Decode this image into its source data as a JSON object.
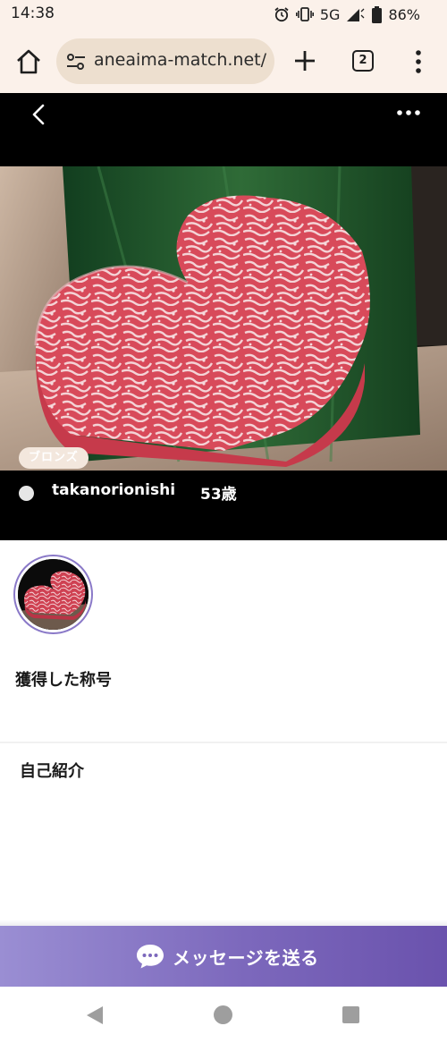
{
  "status_bar": {
    "time": "14:38",
    "network": "5G",
    "battery": "86%",
    "icons": [
      "alarm-icon",
      "vibrate-icon",
      "signal-icon",
      "battery-icon"
    ]
  },
  "browser": {
    "url": "aneaima-match.net/",
    "tab_count": "2",
    "icons": [
      "home-icon",
      "site-settings-icon",
      "new-tab-icon",
      "tab-switcher-icon",
      "overflow-menu-icon"
    ]
  },
  "profile": {
    "rank_badge": "ブロンズ",
    "username": "takanorionishi",
    "age": "53歳",
    "online_status_color": "#e6e6e6"
  },
  "sections": {
    "titles_heading": "獲得した称号",
    "intro_heading": "自己紹介"
  },
  "cta": {
    "label": "メッセージを送る",
    "icon": "chat-bubble-icon",
    "gradient": [
      "#9a8ed3",
      "#6a52ad"
    ]
  },
  "theme": {
    "accent": "#8a79c8",
    "browser_chrome": "#fbf1ea"
  }
}
